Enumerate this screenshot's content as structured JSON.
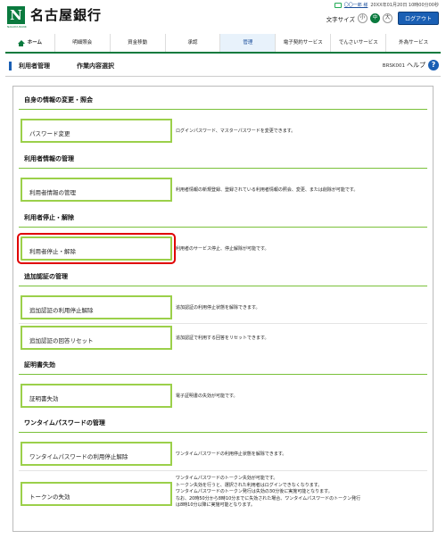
{
  "header": {
    "bank_name": "名古屋銀行",
    "logo_mark": "N",
    "logo_sub": "NAGOYA BANK",
    "user_name": "〇〇一郎 様",
    "last_login": "20XX年01月20日 10時00分00秒",
    "text_size_label": "文字サイズ",
    "text_sizes": [
      "小",
      "中",
      "大"
    ],
    "logout_label": "ログアウト"
  },
  "nav": {
    "items": [
      "ホーム",
      "明細照会",
      "資金移動",
      "承認",
      "管理",
      "電子契約サービス",
      "でんさいサービス",
      "外為サービス"
    ],
    "active_index": 4
  },
  "title": {
    "main": "利用者管理",
    "sub": "作業内容選択",
    "screen_id": "BRSK001",
    "help_label": "ヘルプ",
    "help_icon": "?"
  },
  "sections": [
    {
      "title": "自身の情報の変更・照会"
    },
    {
      "title": "利用者情報の管理"
    },
    {
      "title": "利用者停止・解除"
    },
    {
      "title": "追加認証の管理"
    },
    {
      "title": "証明書失効"
    },
    {
      "title": "ワンタイムパスワードの管理"
    }
  ],
  "items": [
    {
      "label": "パスワード変更",
      "desc": [
        "ログインパスワード、マスターパスワードを変更できます。"
      ]
    },
    {
      "label": "利用者情報の管理",
      "desc": [
        "利用者情報の新規登録、登録されている利用者情報の照会、変更、または削除が可能です。"
      ]
    },
    {
      "label": "利用者停止・解除",
      "desc": [
        "利用者のサービス停止、停止解除が可能です。"
      ]
    },
    {
      "label": "追加認証の利用停止解除",
      "desc": [
        "追加認証の利用停止状態を解除できます。"
      ]
    },
    {
      "label": "追加認証の回答リセット",
      "desc": [
        "追加認証で利用する回答をリセットできます。"
      ]
    },
    {
      "label": "証明書失効",
      "desc": [
        "電子証明書の失効が可能です。"
      ]
    },
    {
      "label": "ワンタイムパスワードの利用停止解除",
      "desc": [
        "ワンタイムパスワードの利用停止状態を解除できます。"
      ]
    },
    {
      "label": "トークンの失効",
      "desc": [
        "ワンタイムパスワードのトークン失効が可能です。",
        "トークン失効を行うと、選択された利用者はログインできなくなります。",
        "ワンタイムパスワードのトークン発行は失効の30分後に実施可能となります。",
        "なお、20時50分から8時10分までに失効された場合、ワンタイムパスワードのトークン発行",
        "は8時10分以降に実施可能となります。"
      ]
    }
  ],
  "colors": {
    "brand_green": "#0a7a3e",
    "accent_blue": "#1a5fb4",
    "item_border": "#9bd04a",
    "highlight_red": "#e00000"
  }
}
